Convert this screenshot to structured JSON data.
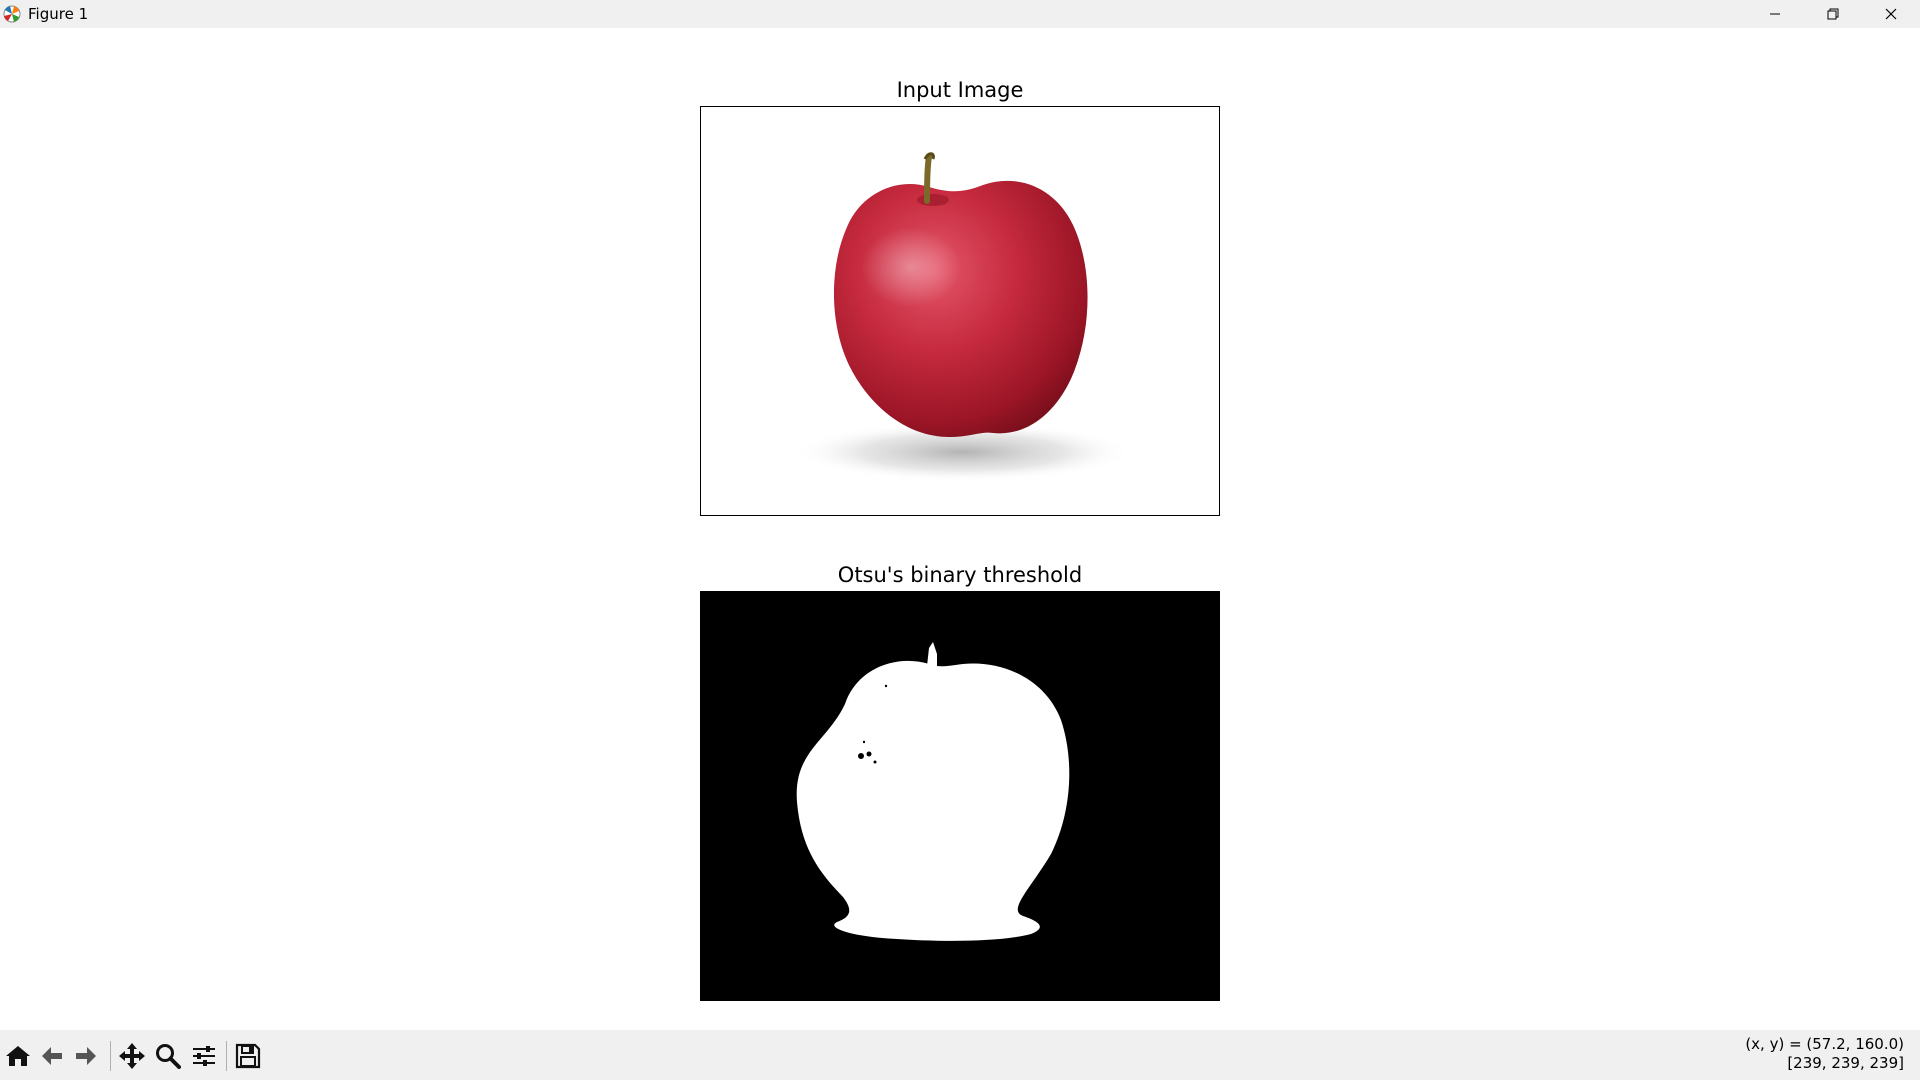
{
  "window": {
    "title": "Figure 1",
    "app_icon": "matplotlib-icon",
    "controls": [
      {
        "name": "minimize-icon"
      },
      {
        "name": "restore-icon"
      },
      {
        "name": "close-icon"
      }
    ]
  },
  "figure": {
    "axes": [
      {
        "title": "Input Image",
        "image": "red apple photo on white background"
      },
      {
        "title": "Otsu's binary threshold",
        "image": "binary mask: white apple silhouette on black background"
      }
    ]
  },
  "toolbar": {
    "tools": [
      {
        "name": "home-icon"
      },
      {
        "name": "back-arrow-icon"
      },
      {
        "name": "forward-arrow-icon"
      },
      {
        "name": "pan-icon"
      },
      {
        "name": "zoom-icon"
      },
      {
        "name": "configure-subplots-icon"
      },
      {
        "name": "save-icon"
      }
    ]
  },
  "status": {
    "coords": "(x, y) = (57.2, 160.0)",
    "pixel_value": "[239, 239, 239]"
  },
  "colors": {
    "toolbar_bg": "#f0f0f0",
    "apple_red": "#c0283a",
    "mask_white": "#ffffff",
    "mask_black": "#000000"
  }
}
